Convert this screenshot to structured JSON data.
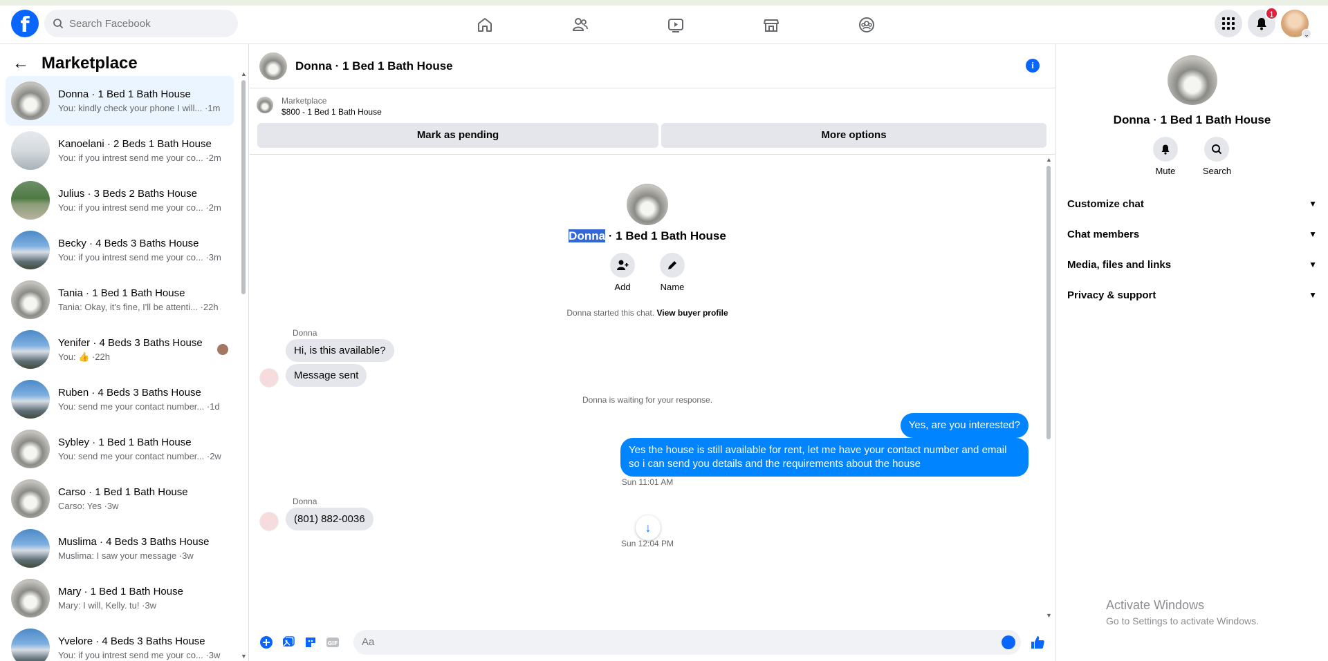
{
  "topbar": {
    "logo": "f",
    "search_placeholder": "Search Facebook",
    "notification_count": "1",
    "nav": [
      "home-icon",
      "friends-icon",
      "video-icon",
      "marketplace-icon",
      "groups-icon"
    ]
  },
  "sidebar": {
    "title": "Marketplace",
    "conversations": [
      {
        "name": "Donna · 1 Bed 1 Bath House",
        "preview": "You: kindly check your phone I will... ·1m"
      },
      {
        "name": "Kanoelani · 2 Beds 1 Bath House",
        "preview": "You: if you intrest send me your co... ·2m"
      },
      {
        "name": "Julius · 3 Beds 2 Baths House",
        "preview": "You: if you intrest send me your co... ·2m"
      },
      {
        "name": "Becky · 4 Beds 3 Baths House",
        "preview": "You: if you intrest send me your co... ·3m"
      },
      {
        "name": "Tania · 1 Bed 1 Bath House",
        "preview": "Tania: Okay, it's fine, I'll be attenti... ·22h"
      },
      {
        "name": "Yenifer · 4 Beds 3 Baths House",
        "preview": "You: 👍 ·22h"
      },
      {
        "name": "Ruben · 4 Beds 3 Baths House",
        "preview": "You: send me your contact number... ·1d"
      },
      {
        "name": "Sybley · 1 Bed 1 Bath House",
        "preview": "You: send me your contact number... ·2w"
      },
      {
        "name": "Carso · 1 Bed 1 Bath House",
        "preview": "Carso: Yes ·3w"
      },
      {
        "name": "Muslima · 4 Beds 3 Baths House",
        "preview": "Muslima: I saw your message ·3w"
      },
      {
        "name": "Mary · 1 Bed 1 Bath House",
        "preview": "Mary: I will, Kelly. tu! ·3w"
      },
      {
        "name": "Yvelore · 4 Beds 3 Baths House",
        "preview": "You: if you intrest send me your co... ·3w"
      }
    ]
  },
  "chat": {
    "title": "Donna · 1 Bed 1 Bath House",
    "listing_label": "Marketplace",
    "listing_price": "$800 - 1 Bed 1 Bath House",
    "mark_pending": "Mark as pending",
    "more_options": "More options",
    "center_name_highlight": "Donna",
    "center_name_rest": " · 1 Bed 1 Bath House",
    "add_label": "Add",
    "name_label": "Name",
    "started_text": "Donna started this chat.",
    "view_profile": "View buyer profile",
    "sender_name": "Donna",
    "msg_in_1": "Hi, is this available?",
    "msg_in_2": "Message sent",
    "waiting_text": "Donna is waiting for your response.",
    "msg_out_1": "Yes, are you interested?",
    "msg_out_2": "Yes the house is still available for rent, let me have your contact number and email so i can send you details and the requirements about the house",
    "time_1": "Sun 11:01 AM",
    "msg_in_3": "(801) 882-0036",
    "time_2": "Sun 12:04 PM",
    "composer_placeholder": "Aa"
  },
  "info_panel": {
    "name": "Donna · 1 Bed 1 Bath House",
    "mute": "Mute",
    "search": "Search",
    "sections": [
      "Customize chat",
      "Chat members",
      "Media, files and links",
      "Privacy & support"
    ]
  },
  "watermark": {
    "line1": "Activate Windows",
    "line2": "Go to Settings to activate Windows."
  },
  "colors": {
    "brand": "#0866ff",
    "outgoing_bubble": "#0084ff",
    "incoming_bubble": "#e4e6eb",
    "badge": "#e41e3f"
  }
}
